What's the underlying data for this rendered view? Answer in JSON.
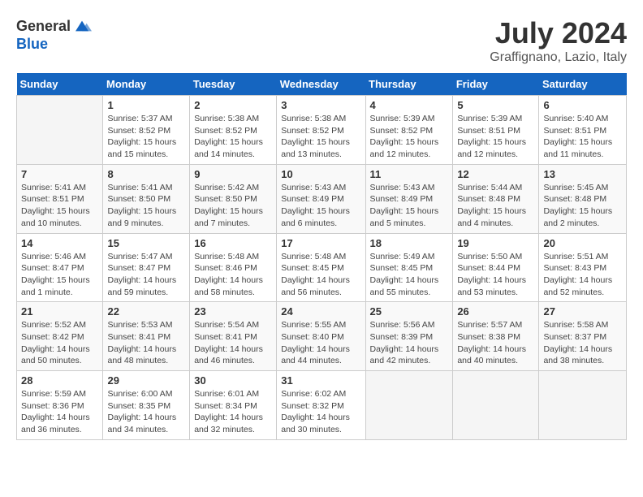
{
  "header": {
    "logo_general": "General",
    "logo_blue": "Blue",
    "month_year": "July 2024",
    "location": "Graffignano, Lazio, Italy"
  },
  "days_of_week": [
    "Sunday",
    "Monday",
    "Tuesday",
    "Wednesday",
    "Thursday",
    "Friday",
    "Saturday"
  ],
  "weeks": [
    [
      {
        "day": "",
        "info": ""
      },
      {
        "day": "1",
        "info": "Sunrise: 5:37 AM\nSunset: 8:52 PM\nDaylight: 15 hours\nand 15 minutes."
      },
      {
        "day": "2",
        "info": "Sunrise: 5:38 AM\nSunset: 8:52 PM\nDaylight: 15 hours\nand 14 minutes."
      },
      {
        "day": "3",
        "info": "Sunrise: 5:38 AM\nSunset: 8:52 PM\nDaylight: 15 hours\nand 13 minutes."
      },
      {
        "day": "4",
        "info": "Sunrise: 5:39 AM\nSunset: 8:52 PM\nDaylight: 15 hours\nand 12 minutes."
      },
      {
        "day": "5",
        "info": "Sunrise: 5:39 AM\nSunset: 8:51 PM\nDaylight: 15 hours\nand 12 minutes."
      },
      {
        "day": "6",
        "info": "Sunrise: 5:40 AM\nSunset: 8:51 PM\nDaylight: 15 hours\nand 11 minutes."
      }
    ],
    [
      {
        "day": "7",
        "info": "Sunrise: 5:41 AM\nSunset: 8:51 PM\nDaylight: 15 hours\nand 10 minutes."
      },
      {
        "day": "8",
        "info": "Sunrise: 5:41 AM\nSunset: 8:50 PM\nDaylight: 15 hours\nand 9 minutes."
      },
      {
        "day": "9",
        "info": "Sunrise: 5:42 AM\nSunset: 8:50 PM\nDaylight: 15 hours\nand 7 minutes."
      },
      {
        "day": "10",
        "info": "Sunrise: 5:43 AM\nSunset: 8:49 PM\nDaylight: 15 hours\nand 6 minutes."
      },
      {
        "day": "11",
        "info": "Sunrise: 5:43 AM\nSunset: 8:49 PM\nDaylight: 15 hours\nand 5 minutes."
      },
      {
        "day": "12",
        "info": "Sunrise: 5:44 AM\nSunset: 8:48 PM\nDaylight: 15 hours\nand 4 minutes."
      },
      {
        "day": "13",
        "info": "Sunrise: 5:45 AM\nSunset: 8:48 PM\nDaylight: 15 hours\nand 2 minutes."
      }
    ],
    [
      {
        "day": "14",
        "info": "Sunrise: 5:46 AM\nSunset: 8:47 PM\nDaylight: 15 hours\nand 1 minute."
      },
      {
        "day": "15",
        "info": "Sunrise: 5:47 AM\nSunset: 8:47 PM\nDaylight: 14 hours\nand 59 minutes."
      },
      {
        "day": "16",
        "info": "Sunrise: 5:48 AM\nSunset: 8:46 PM\nDaylight: 14 hours\nand 58 minutes."
      },
      {
        "day": "17",
        "info": "Sunrise: 5:48 AM\nSunset: 8:45 PM\nDaylight: 14 hours\nand 56 minutes."
      },
      {
        "day": "18",
        "info": "Sunrise: 5:49 AM\nSunset: 8:45 PM\nDaylight: 14 hours\nand 55 minutes."
      },
      {
        "day": "19",
        "info": "Sunrise: 5:50 AM\nSunset: 8:44 PM\nDaylight: 14 hours\nand 53 minutes."
      },
      {
        "day": "20",
        "info": "Sunrise: 5:51 AM\nSunset: 8:43 PM\nDaylight: 14 hours\nand 52 minutes."
      }
    ],
    [
      {
        "day": "21",
        "info": "Sunrise: 5:52 AM\nSunset: 8:42 PM\nDaylight: 14 hours\nand 50 minutes."
      },
      {
        "day": "22",
        "info": "Sunrise: 5:53 AM\nSunset: 8:41 PM\nDaylight: 14 hours\nand 48 minutes."
      },
      {
        "day": "23",
        "info": "Sunrise: 5:54 AM\nSunset: 8:41 PM\nDaylight: 14 hours\nand 46 minutes."
      },
      {
        "day": "24",
        "info": "Sunrise: 5:55 AM\nSunset: 8:40 PM\nDaylight: 14 hours\nand 44 minutes."
      },
      {
        "day": "25",
        "info": "Sunrise: 5:56 AM\nSunset: 8:39 PM\nDaylight: 14 hours\nand 42 minutes."
      },
      {
        "day": "26",
        "info": "Sunrise: 5:57 AM\nSunset: 8:38 PM\nDaylight: 14 hours\nand 40 minutes."
      },
      {
        "day": "27",
        "info": "Sunrise: 5:58 AM\nSunset: 8:37 PM\nDaylight: 14 hours\nand 38 minutes."
      }
    ],
    [
      {
        "day": "28",
        "info": "Sunrise: 5:59 AM\nSunset: 8:36 PM\nDaylight: 14 hours\nand 36 minutes."
      },
      {
        "day": "29",
        "info": "Sunrise: 6:00 AM\nSunset: 8:35 PM\nDaylight: 14 hours\nand 34 minutes."
      },
      {
        "day": "30",
        "info": "Sunrise: 6:01 AM\nSunset: 8:34 PM\nDaylight: 14 hours\nand 32 minutes."
      },
      {
        "day": "31",
        "info": "Sunrise: 6:02 AM\nSunset: 8:32 PM\nDaylight: 14 hours\nand 30 minutes."
      },
      {
        "day": "",
        "info": ""
      },
      {
        "day": "",
        "info": ""
      },
      {
        "day": "",
        "info": ""
      }
    ]
  ]
}
